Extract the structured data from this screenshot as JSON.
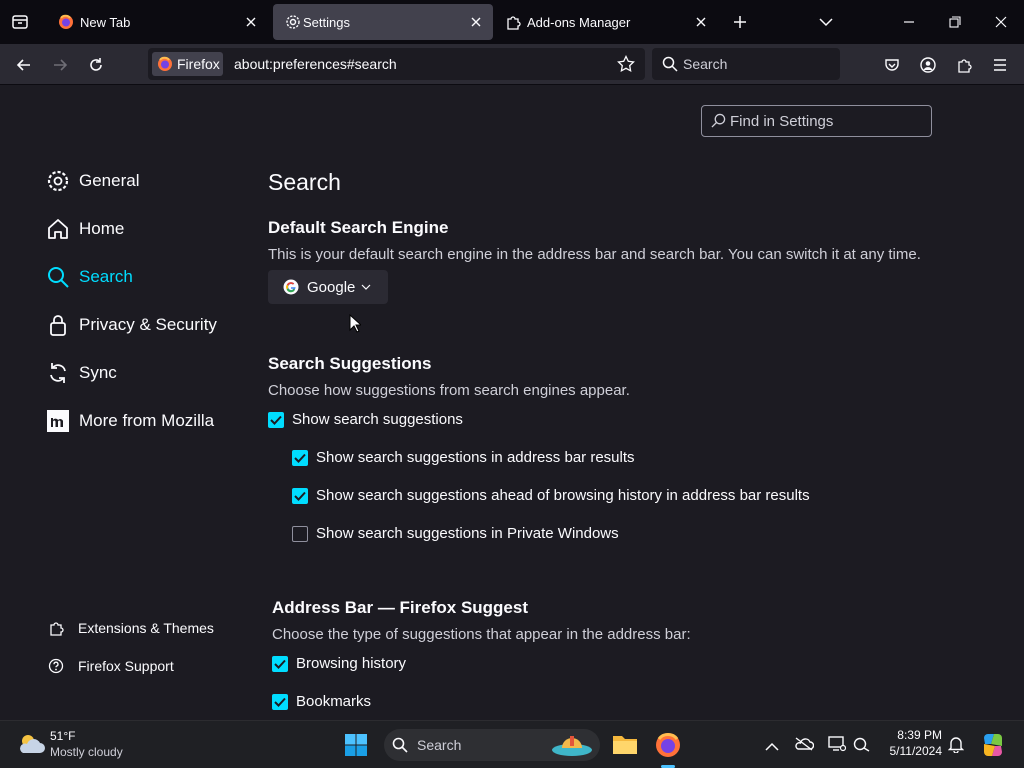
{
  "tabs": [
    {
      "label": "New Tab",
      "icon": "firefox-logo-icon"
    },
    {
      "label": "Settings",
      "icon": "gear-icon",
      "active": true
    },
    {
      "label": "Add-ons Manager",
      "icon": "puzzle-icon"
    }
  ],
  "navbar": {
    "identity_label": "Firefox",
    "url": "about:preferences#search",
    "search_placeholder": "Search"
  },
  "find": {
    "placeholder": "Find in Settings"
  },
  "sidebar": {
    "items": [
      {
        "label": "General",
        "icon": "gear-icon"
      },
      {
        "label": "Home",
        "icon": "home-icon"
      },
      {
        "label": "Search",
        "icon": "search-icon",
        "selected": true
      },
      {
        "label": "Privacy & Security",
        "icon": "lock-icon"
      },
      {
        "label": "Sync",
        "icon": "sync-icon"
      },
      {
        "label": "More from Mozilla",
        "icon": "mozilla-icon"
      }
    ],
    "footer": [
      {
        "label": "Extensions & Themes",
        "icon": "puzzle-icon"
      },
      {
        "label": "Firefox Support",
        "icon": "help-icon"
      }
    ]
  },
  "main": {
    "title": "Search",
    "default_engine": {
      "heading": "Default Search Engine",
      "description": "This is your default search engine in the address bar and search bar. You can switch it at any time.",
      "selected": "Google"
    },
    "suggestions": {
      "heading": "Search Suggestions",
      "description": "Choose how suggestions from search engines appear.",
      "options": [
        {
          "label": "Show search suggestions",
          "checked": true
        },
        {
          "label": "Show search suggestions in address bar results",
          "checked": true
        },
        {
          "label": "Show search suggestions ahead of browsing history in address bar results",
          "checked": true
        },
        {
          "label": "Show search suggestions in Private Windows",
          "checked": false
        }
      ]
    },
    "address_bar": {
      "heading": "Address Bar — Firefox Suggest",
      "description": "Choose the type of suggestions that appear in the address bar:",
      "options": [
        {
          "label": "Browsing history",
          "checked": true
        },
        {
          "label": "Bookmarks",
          "checked": true
        }
      ]
    }
  },
  "taskbar": {
    "weather_temp": "51°F",
    "weather_desc": "Mostly cloudy",
    "search_placeholder": "Search",
    "time": "8:39 PM",
    "date": "5/11/2024"
  },
  "colors": {
    "accent": "#00ddff",
    "bg": "#1c1b22",
    "tabbar": "#0c0b11",
    "toolbar": "#2b2a33"
  }
}
